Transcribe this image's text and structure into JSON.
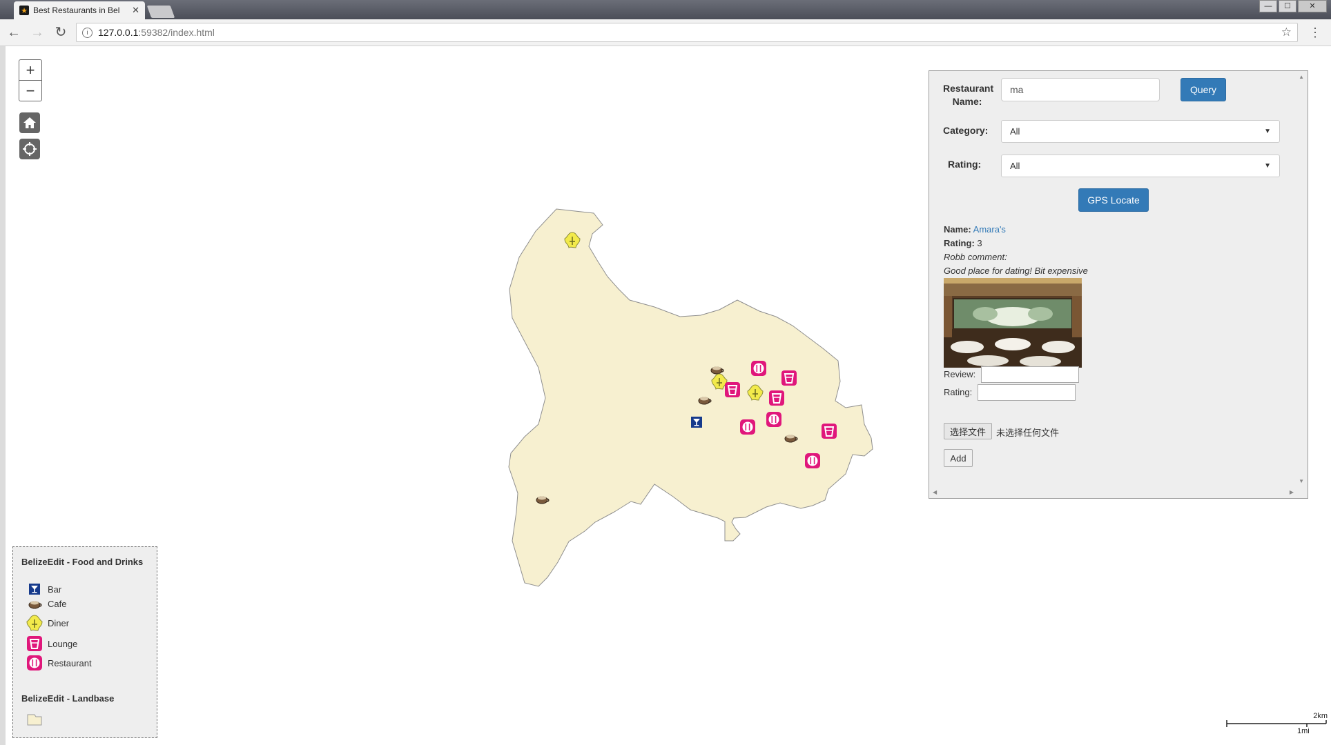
{
  "browser": {
    "tab_title": "Best Restaurants in Bel",
    "tab_close": "✕",
    "favicon": "★",
    "url_host": "127.0.0.1",
    "url_rest": ":59382/index.html",
    "back": "←",
    "forward": "→",
    "reload": "↻",
    "star": "☆",
    "menu": "⋮",
    "win_min": "—",
    "win_max": "☐",
    "win_close": "✕"
  },
  "map": {
    "zoom_in": "+",
    "zoom_out": "−",
    "land_color": "#f7f0d0",
    "pin_colors": {
      "restaurant": "#e0177b",
      "lounge": "#e0177b",
      "bar": "#163a8c",
      "diner": "#f2ea4b"
    },
    "scale": {
      "top": "2km",
      "bottom": "1mi"
    }
  },
  "panel": {
    "name_label_1": "Restaurant",
    "name_label_2": "Name:",
    "name_value": "ma",
    "query_button": "Query",
    "category_label": "Category:",
    "category_value": "All",
    "rating_label": "Rating:",
    "rating_value": "All",
    "gps_button": "GPS Locate",
    "result": {
      "name_key": "Name:",
      "name_value": "Amara's",
      "rating_key": "Rating:",
      "rating_value": "3",
      "comment_author": "Robb comment:",
      "comment_text": "Good place for dating! Bit expensive"
    },
    "review_label": "Review:",
    "rating_input_label": "Rating:",
    "file_button": "选择文件",
    "file_status": "未选择任何文件",
    "add_button": "Add"
  },
  "legend": {
    "group1_title": "BelizeEdit - Food and Drinks",
    "items": [
      {
        "label": "Bar",
        "icon": "bar-icon"
      },
      {
        "label": "Cafe",
        "icon": "cafe-icon"
      },
      {
        "label": "Diner",
        "icon": "diner-icon"
      },
      {
        "label": "Lounge",
        "icon": "lounge-icon"
      },
      {
        "label": "Restaurant",
        "icon": "restaurant-icon"
      }
    ],
    "group2_title": "BelizeEdit - Landbase"
  }
}
